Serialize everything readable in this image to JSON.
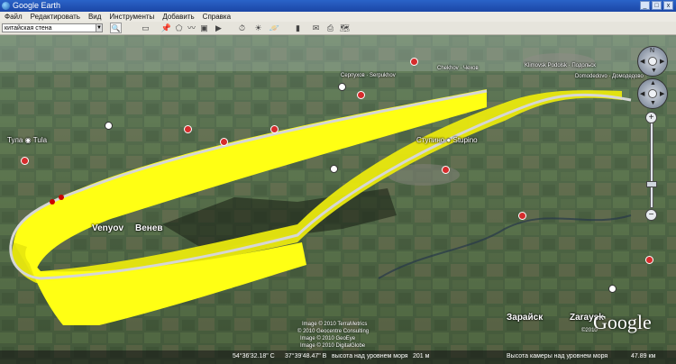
{
  "window": {
    "title": "Google Earth",
    "buttons": [
      "_",
      "□",
      "x"
    ]
  },
  "menu": [
    "Файл",
    "Редактировать",
    "Вид",
    "Инструменты",
    "Добавить",
    "Справка"
  ],
  "search": {
    "value": "китайская стена",
    "button_icon": "search-icon"
  },
  "toolbar_icons": [
    "sidebar-icon",
    "placemark-icon",
    "polygon-icon",
    "path-icon",
    "overlay-icon",
    "tour-icon",
    "history-icon",
    "sun-icon",
    "planet-icon",
    "ruler-icon",
    "email-icon",
    "print-icon",
    "maps-icon"
  ],
  "map": {
    "labels": {
      "tula": "Тула ◉ Tula",
      "venyov_en": "Venyov",
      "venyov_ru": "Венев",
      "stupino": "Ступино ● Stupino",
      "zaraysk_ru": "Зарайск",
      "zaraysk_en": "Zaraysk",
      "serpukhov": "Серпухов · Serpukhov",
      "chekhov": "Chekhov · Чехов",
      "podolsk": "Klimovsk  Podolsk · Подольск",
      "domodedovo": "Domodedovo · Домодедово"
    },
    "credits": [
      "Image © 2010 TerraMetrics",
      "© 2010 Geocentre Consulting",
      "Image © 2010 GeoEye",
      "Image © 2010 DigitalGlobe"
    ],
    "logo": "Google",
    "year": "©2010"
  },
  "status": {
    "coords": "54°36'32.18\" С",
    "lon": "37°39'48.47\" В",
    "elev_label": "высота над уровнем моря",
    "elev": "201 м",
    "eye_label": "Высота камеры над уровнем моря",
    "eye": "47.89 км"
  },
  "colors": {
    "ribbon": "#ffff14",
    "ribbon_shade": "#c8c812",
    "titlebar": "#1f4fb3"
  }
}
